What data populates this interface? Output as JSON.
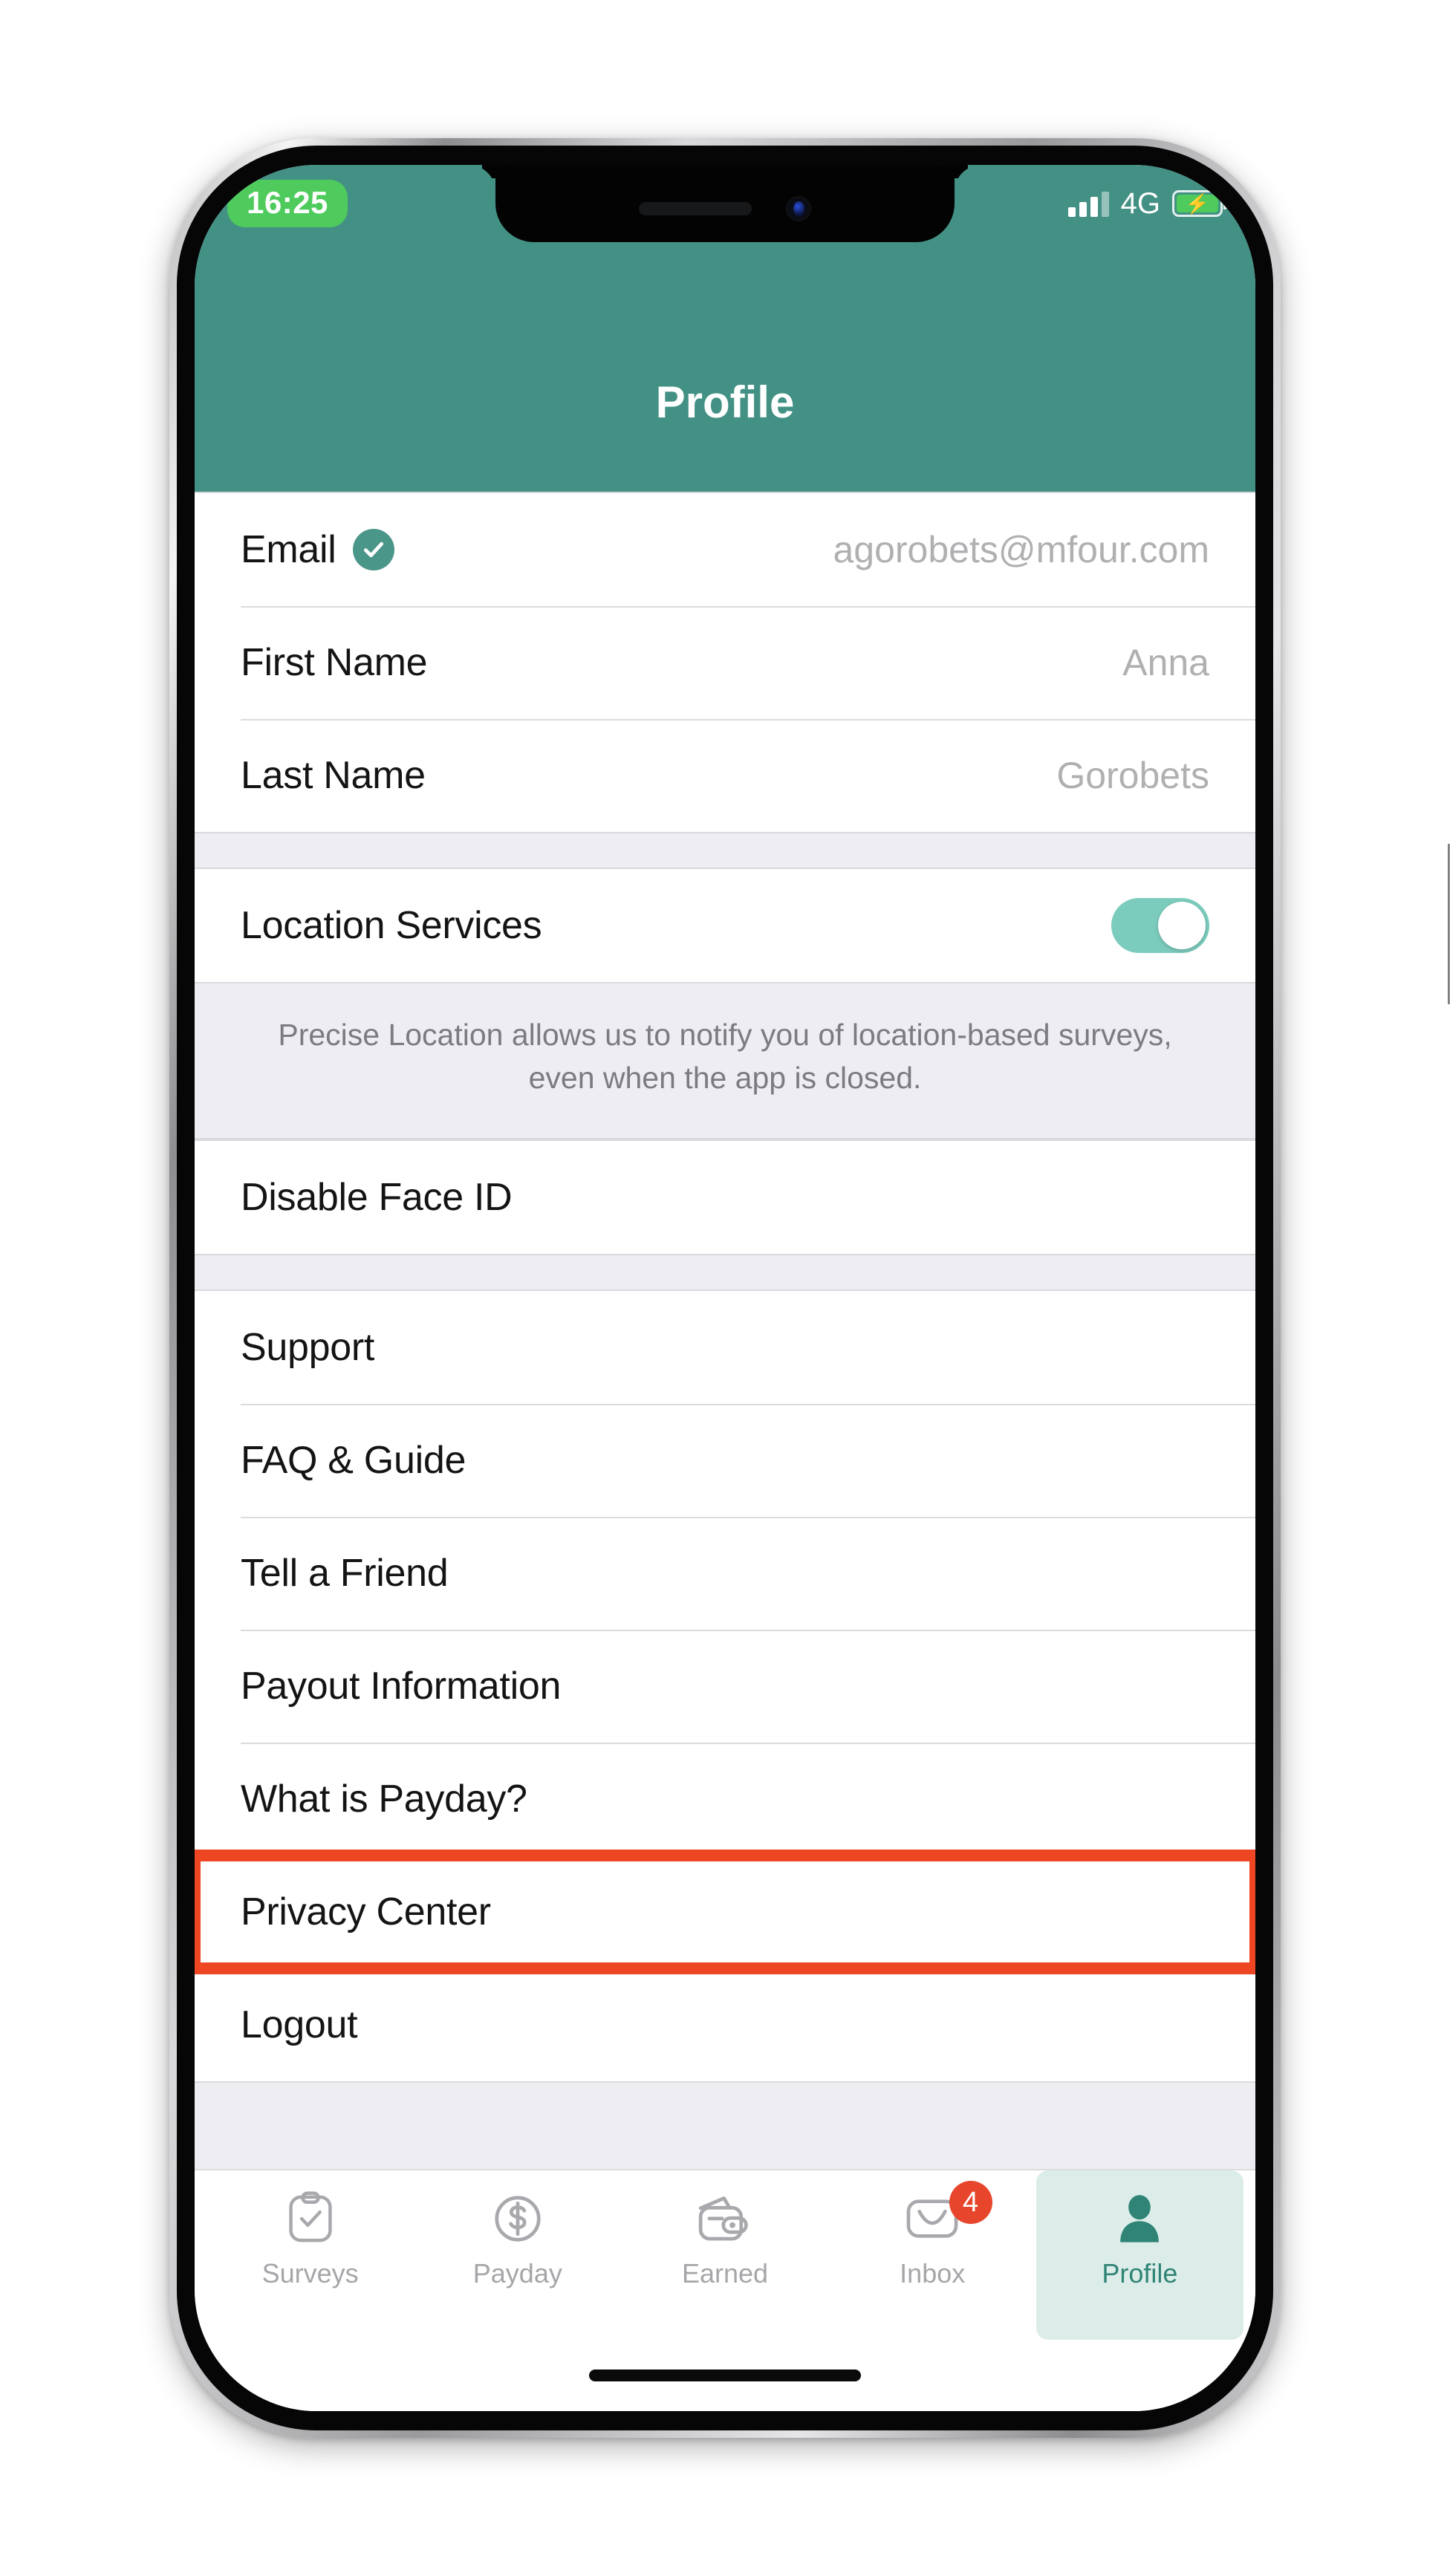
{
  "status_bar": {
    "time": "16:25",
    "network": "4G",
    "signal_icon": "signal-bars-icon",
    "battery_icon": "battery-charging-icon",
    "battery_bolt": "⚡"
  },
  "header": {
    "title": "Profile",
    "accent_color": "#439184",
    "time_pill_color": "#4ECB5C"
  },
  "account_section": {
    "rows": [
      {
        "label": "Email",
        "value": "agorobets@mfour.com",
        "verified": true,
        "verified_icon": "check-circle-icon"
      },
      {
        "label": "First Name",
        "value": "Anna",
        "verified": false
      },
      {
        "label": "Last Name",
        "value": "Gorobets",
        "verified": false
      }
    ]
  },
  "location_section": {
    "label": "Location Services",
    "toggle_state": "on",
    "toggle_color": "#7CCCBD",
    "help_text": "Precise Location allows us to notify you of location-based surveys, even when the app is closed."
  },
  "security_section": {
    "rows": [
      {
        "label": "Disable Face ID"
      }
    ]
  },
  "support_section": {
    "rows": [
      {
        "label": "Support",
        "highlighted": false
      },
      {
        "label": "FAQ & Guide",
        "highlighted": false
      },
      {
        "label": "Tell a Friend",
        "highlighted": false
      },
      {
        "label": "Payout Information",
        "highlighted": false
      },
      {
        "label": "What is Payday?",
        "highlighted": false
      },
      {
        "label": "Privacy Center",
        "highlighted": true
      },
      {
        "label": "Logout",
        "highlighted": false
      }
    ],
    "highlight_color": "#EE4522"
  },
  "tab_bar": {
    "active_tab": "Profile",
    "active_bg": "#DCEDE9",
    "active_color": "#2F8476",
    "badge_color": "#E8462C",
    "tabs": [
      {
        "label": "Surveys",
        "icon": "clipboard-check-icon",
        "badge": "",
        "active": false
      },
      {
        "label": "Payday",
        "icon": "dollar-circle-icon",
        "badge": "",
        "active": false
      },
      {
        "label": "Earned",
        "icon": "wallet-icon",
        "badge": "",
        "active": false
      },
      {
        "label": "Inbox",
        "icon": "envelope-icon",
        "badge": "4",
        "active": false
      },
      {
        "label": "Profile",
        "icon": "person-icon",
        "badge": "",
        "active": true
      }
    ]
  }
}
